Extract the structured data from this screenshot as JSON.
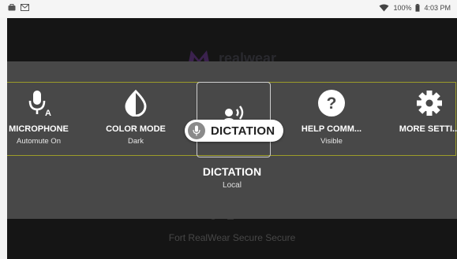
{
  "statusbar": {
    "battery": "100%",
    "time": "4:03 PM"
  },
  "background": {
    "logo_text": "realwear",
    "footer_text": "Fort RealWear Secure Secure"
  },
  "carousel": {
    "items": [
      {
        "label": "MICROPHONE",
        "sub": "Automute On",
        "icon": "microphone-icon"
      },
      {
        "label": "COLOR MODE",
        "sub": "Dark",
        "icon": "color-mode-icon"
      },
      {
        "label": "",
        "sub": "",
        "icon": "dictation-icon"
      },
      {
        "label": "HELP COMM...",
        "sub": "Visible",
        "icon": "help-icon"
      },
      {
        "label": "MORE SETTI...",
        "sub": "",
        "icon": "gear-icon"
      }
    ],
    "selected_index": 2
  },
  "voice_pill": {
    "text": "DICTATION"
  },
  "selected": {
    "title": "DICTATION",
    "subtitle": "Local"
  },
  "colors": {
    "panel": "#484848",
    "strip_border": "#9c9c2a",
    "screen": "#151515"
  }
}
